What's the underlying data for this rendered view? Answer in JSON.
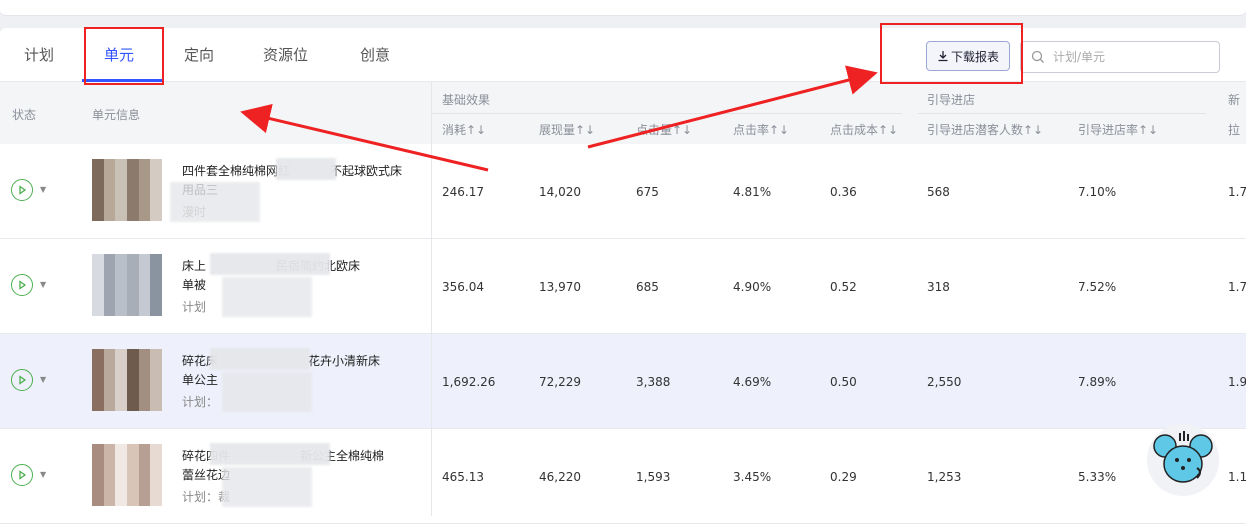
{
  "tabs": [
    {
      "label": "计划"
    },
    {
      "label": "单元"
    },
    {
      "label": "定向"
    },
    {
      "label": "资源位"
    },
    {
      "label": "创意"
    }
  ],
  "toolbar": {
    "download_label": "下载报表",
    "search_placeholder": "计划/单元"
  },
  "table": {
    "headers": {
      "status": "状态",
      "unit_info": "单元信息",
      "group_basic": "基础效果",
      "group_guide": "引导进店",
      "group_new": "新",
      "cost": "消耗↑↓",
      "impressions": "展现量↑↓",
      "clicks": "点击量↑↓",
      "ctr": "点击率↑↓",
      "cpc": "点击成本↑↓",
      "guide_visitors": "引导进店潜客人数↑↓",
      "guide_rate": "引导进店率↑↓",
      "new_col": "拉"
    },
    "rows": [
      {
        "name1": "四件套全棉纯棉网红",
        "name1b": "不起球欧式床",
        "name2": "用品三",
        "sub": "漫时",
        "cost": "246.17",
        "impressions": "14,020",
        "clicks": "675",
        "ctr": "4.81%",
        "cpc": "0.36",
        "guide_visitors": "568",
        "guide_rate": "7.10%",
        "new_col": "1.7"
      },
      {
        "name1": "床上",
        "name1b": "民宿简约北欧床",
        "name2": "单被",
        "sub": "计划",
        "cost": "356.04",
        "impressions": "13,970",
        "clicks": "685",
        "ctr": "4.90%",
        "cpc": "0.52",
        "guide_visitors": "318",
        "guide_rate": "7.52%",
        "new_col": "1.7"
      },
      {
        "name1": "碎花床",
        "name1b": "花卉小清新床",
        "name2": "单公主",
        "sub": "计划：",
        "cost": "1,692.26",
        "impressions": "72,229",
        "clicks": "3,388",
        "ctr": "4.69%",
        "cpc": "0.50",
        "guide_visitors": "2,550",
        "guide_rate": "7.89%",
        "new_col": "1.9"
      },
      {
        "name1": "碎花四件",
        "name1b": "新公主全棉纯棉",
        "name2": "蕾丝花边",
        "sub": "计划：裁",
        "cost": "465.13",
        "impressions": "46,220",
        "clicks": "1,593",
        "ctr": "3.45%",
        "cpc": "0.29",
        "guide_visitors": "1,253",
        "guide_rate": "5.33%",
        "new_col": "1.1"
      }
    ]
  },
  "colors": {
    "accent": "#3355ff",
    "annotation_red": "#ee2222",
    "play_green": "#4caf50"
  }
}
